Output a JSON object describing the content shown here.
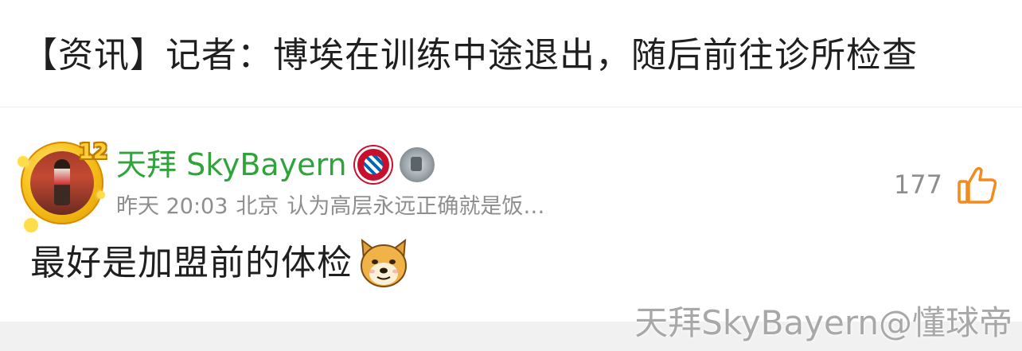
{
  "header": {
    "title": "【资讯】记者：博埃在训练中途退出，随后前往诊所检查"
  },
  "comment": {
    "user": {
      "name": "天拜 SkyBayern",
      "level_badge": "12",
      "badges": [
        "fc-bayern-badge-icon",
        "bundesliga-trophy-badge-icon"
      ]
    },
    "meta": {
      "time": "昨天 20:03",
      "location": "北京",
      "bio": "认为高层永远正确就是饭…"
    },
    "likes": {
      "count": "177",
      "icon": "thumbs-up-icon"
    },
    "text": "最好是加盟前的体检",
    "emoji": "doge-emoji-icon"
  },
  "watermark": "天拜SkyBayern@懂球帝",
  "colors": {
    "username": "#2ea43a",
    "like_icon": "#f38a1d",
    "meta": "#8e8e8e",
    "watermark": "#a8a8a8"
  }
}
